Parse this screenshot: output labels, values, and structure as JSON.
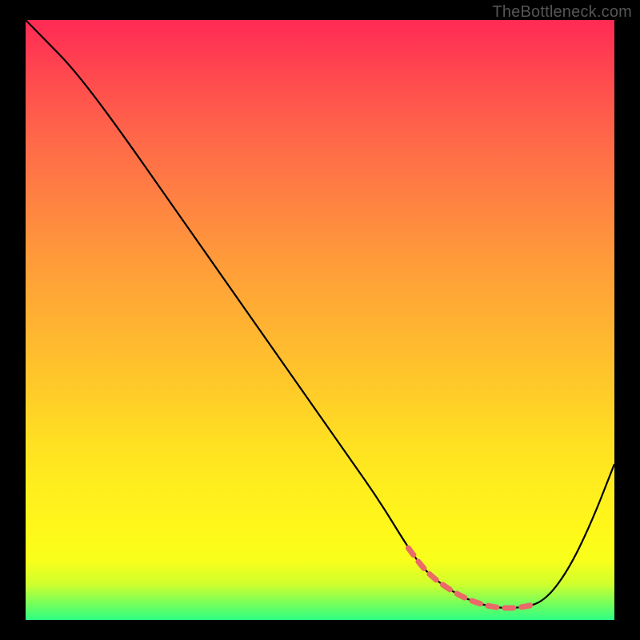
{
  "credit": "TheBottleneck.com",
  "colors": {
    "curve": "#000000",
    "dash": "#e96a68",
    "background": "#000000"
  },
  "chart_data": {
    "type": "line",
    "title": "",
    "xlabel": "",
    "ylabel": "",
    "xlim": [
      0,
      100
    ],
    "ylim": [
      0,
      100
    ],
    "grid": false,
    "description": "Bottleneck-style curve: high on the left, descends to a flat minimum region around x≈68–88, then rises again on the right. The flat minimum band is highlighted with a dashed segment.",
    "series": [
      {
        "name": "bottleneck-curve",
        "x": [
          0,
          3,
          8,
          15,
          25,
          35,
          45,
          55,
          60,
          65,
          68,
          72,
          76,
          80,
          84,
          88,
          92,
          96,
          100
        ],
        "y": [
          100,
          97,
          92,
          83,
          69,
          55,
          41,
          27,
          20,
          12,
          8,
          5,
          3,
          2,
          2,
          3,
          8,
          16,
          26
        ]
      }
    ],
    "highlight_range_x": [
      64,
      90
    ],
    "annotations": []
  }
}
